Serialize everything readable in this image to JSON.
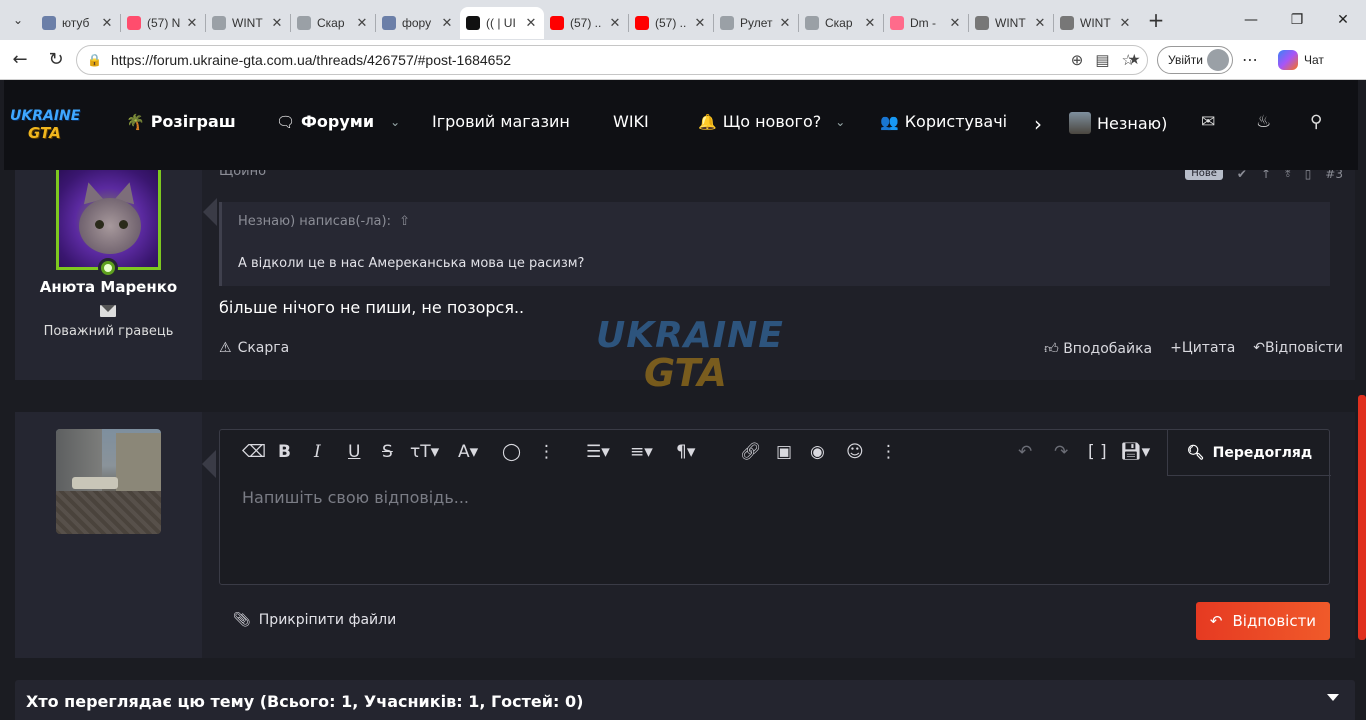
{
  "browser": {
    "tabs": [
      {
        "title": "ютуб",
        "favicon": "search",
        "color": "#6b7fa8"
      },
      {
        "title": "(57) N",
        "favicon": "youtube",
        "color": "#ff4d6d"
      },
      {
        "title": "WINT",
        "favicon": "image",
        "color": "#9aa0a6"
      },
      {
        "title": "Скар",
        "favicon": "image",
        "color": "#9aa0a6"
      },
      {
        "title": "фору",
        "favicon": "search",
        "color": "#6b7fa8"
      },
      {
        "title": "(( | UI",
        "favicon": "ugta",
        "color": "#111111",
        "active": true
      },
      {
        "title": "(57) ..",
        "favicon": "youtube",
        "color": "#ff0000"
      },
      {
        "title": "(57) ..",
        "favicon": "youtube",
        "color": "#ff0000"
      },
      {
        "title": "Рулет",
        "favicon": "image",
        "color": "#9aa0a6"
      },
      {
        "title": "Скар",
        "favicon": "image",
        "color": "#9aa0a6"
      },
      {
        "title": "Dm -",
        "favicon": "youtube",
        "color": "#ff6b8b"
      },
      {
        "title": "WINT",
        "favicon": "info",
        "color": "#777777"
      },
      {
        "title": "WINT",
        "favicon": "info",
        "color": "#777777"
      }
    ],
    "url": "https://forum.ukraine-gta.com.ua/threads/426757/#post-1684652",
    "signin_label": "Увійти",
    "copilot_label": "Чат"
  },
  "site": {
    "logo_text_1": "UKRAINE",
    "logo_text_2": "GTA",
    "nav": {
      "giveaway": "Розіграш",
      "forums": "Форуми",
      "shop": "Ігровий магазин",
      "wiki": "WIKI",
      "whats_new": "Що нового?",
      "users": "Користувачі",
      "account": "Незнаю)"
    }
  },
  "post": {
    "time": "Щойно",
    "badge": "Нове",
    "number": "#3",
    "author": "Анюта Маренко",
    "rank": "Поважний гравець",
    "quote_header": "Незнаю) написав(-ла):",
    "quote_body": "А відколи це в нас Амереканська мова це расизм?",
    "body": "більше нічого не пиши, не позорся..",
    "report": "Скарга",
    "like": "Вподобайка",
    "quote_action": "Цитата",
    "reply_action": "Відповісти"
  },
  "editor": {
    "preview": "Передогляд",
    "placeholder": "Напишіть свою відповідь...",
    "attach": "Прикріпити файли",
    "submit": "Відповісти"
  },
  "viewers": {
    "title": "Хто переглядає цю тему (Всього: 1, Учасників: 1, Гостей: 0)"
  }
}
